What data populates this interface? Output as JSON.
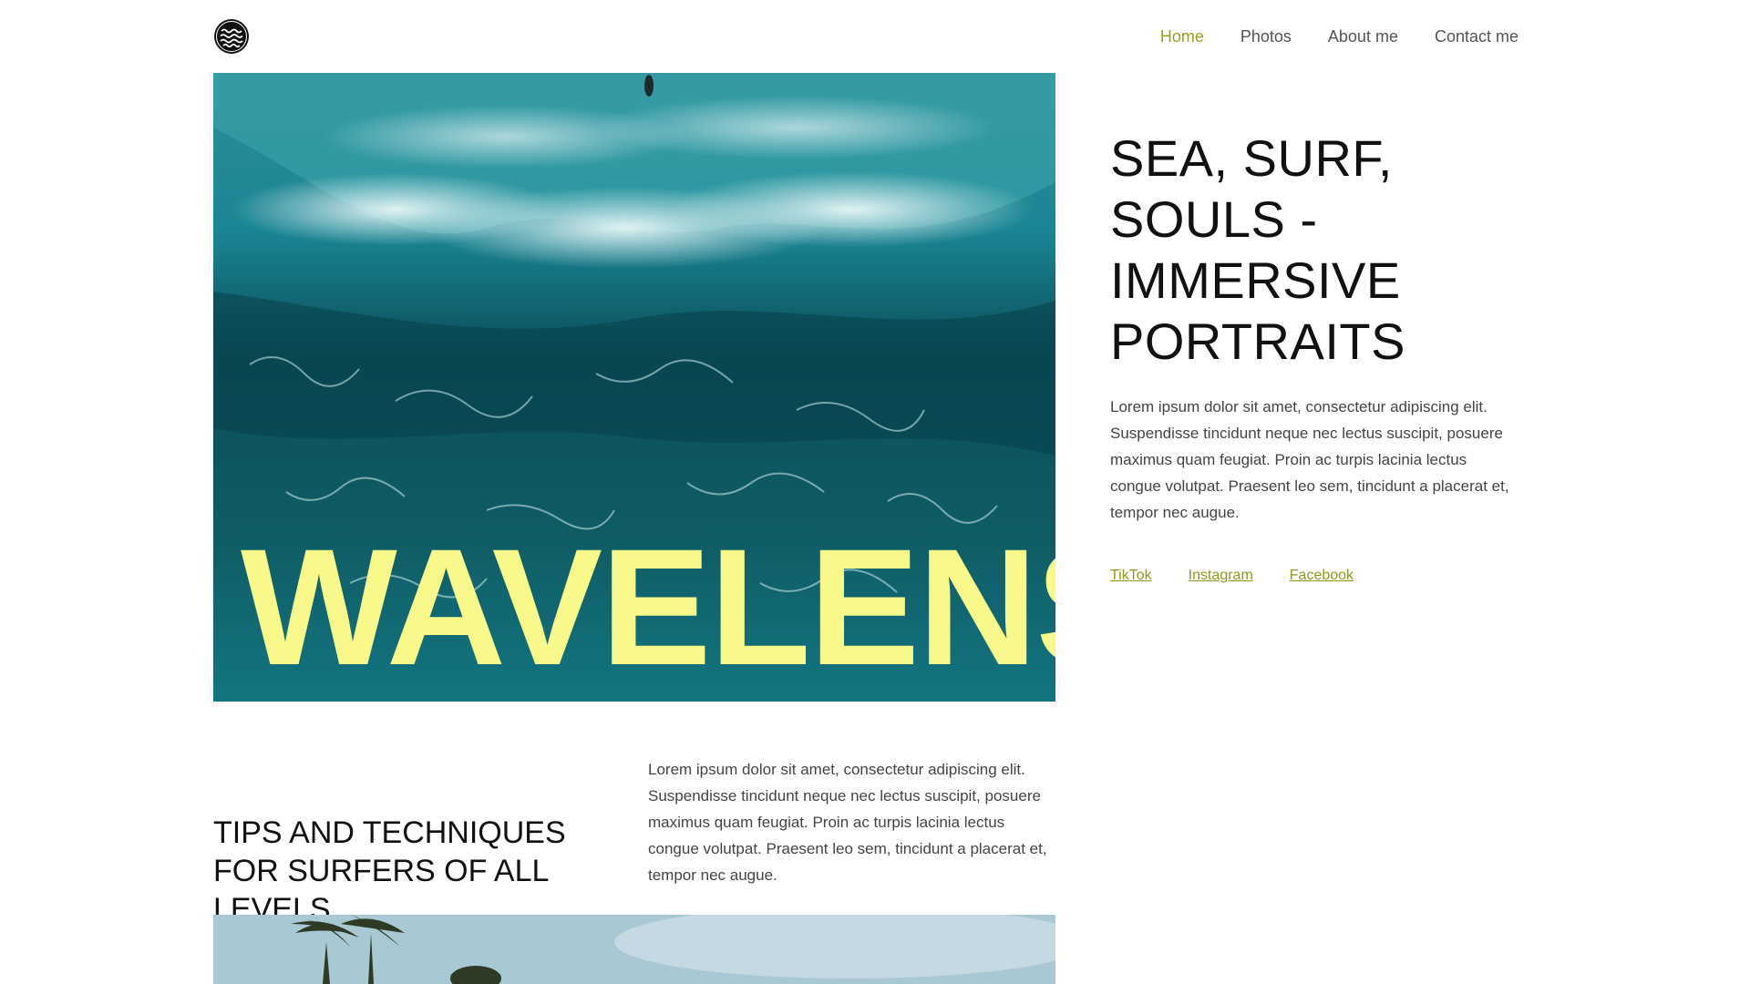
{
  "header": {
    "logo_icon": "wave-circle-logo-icon",
    "nav": [
      {
        "label": "Home",
        "active": true
      },
      {
        "label": "Photos",
        "active": false
      },
      {
        "label": "About me",
        "active": false
      },
      {
        "label": "Contact me",
        "active": false
      }
    ]
  },
  "hero": {
    "word": "WAVELENS",
    "word_color": "#f8f98a"
  },
  "intro": {
    "title": "SEA, SURF, SOULS - IMMERSIVE PORTRAITS",
    "text": "Lorem ipsum dolor sit amet, consectetur adipiscing elit. Suspendisse tincidunt neque nec lectus suscipit, posuere maximus quam feugiat. Proin ac turpis lacinia lectus congue volutpat. Praesent leo sem, tincidunt a placerat et, tempor nec augue.",
    "social": [
      "TikTok",
      "Instagram",
      "Facebook"
    ]
  },
  "tips": {
    "title": "TIPS AND TECHNIQUES FOR SURFERS OF ALL LEVELS.",
    "text": "Lorem ipsum dolor sit amet, consectetur adipiscing elit. Suspendisse tincidunt neque nec lectus suscipit, posuere maximus quam feugiat. Proin ac turpis lacinia lectus congue volutpat. Praesent leo sem, tincidunt a placerat et, tempor nec augue."
  },
  "colors": {
    "accent": "#9aa21d",
    "link": "#8f9a1a",
    "sea": "#0f4f57"
  }
}
